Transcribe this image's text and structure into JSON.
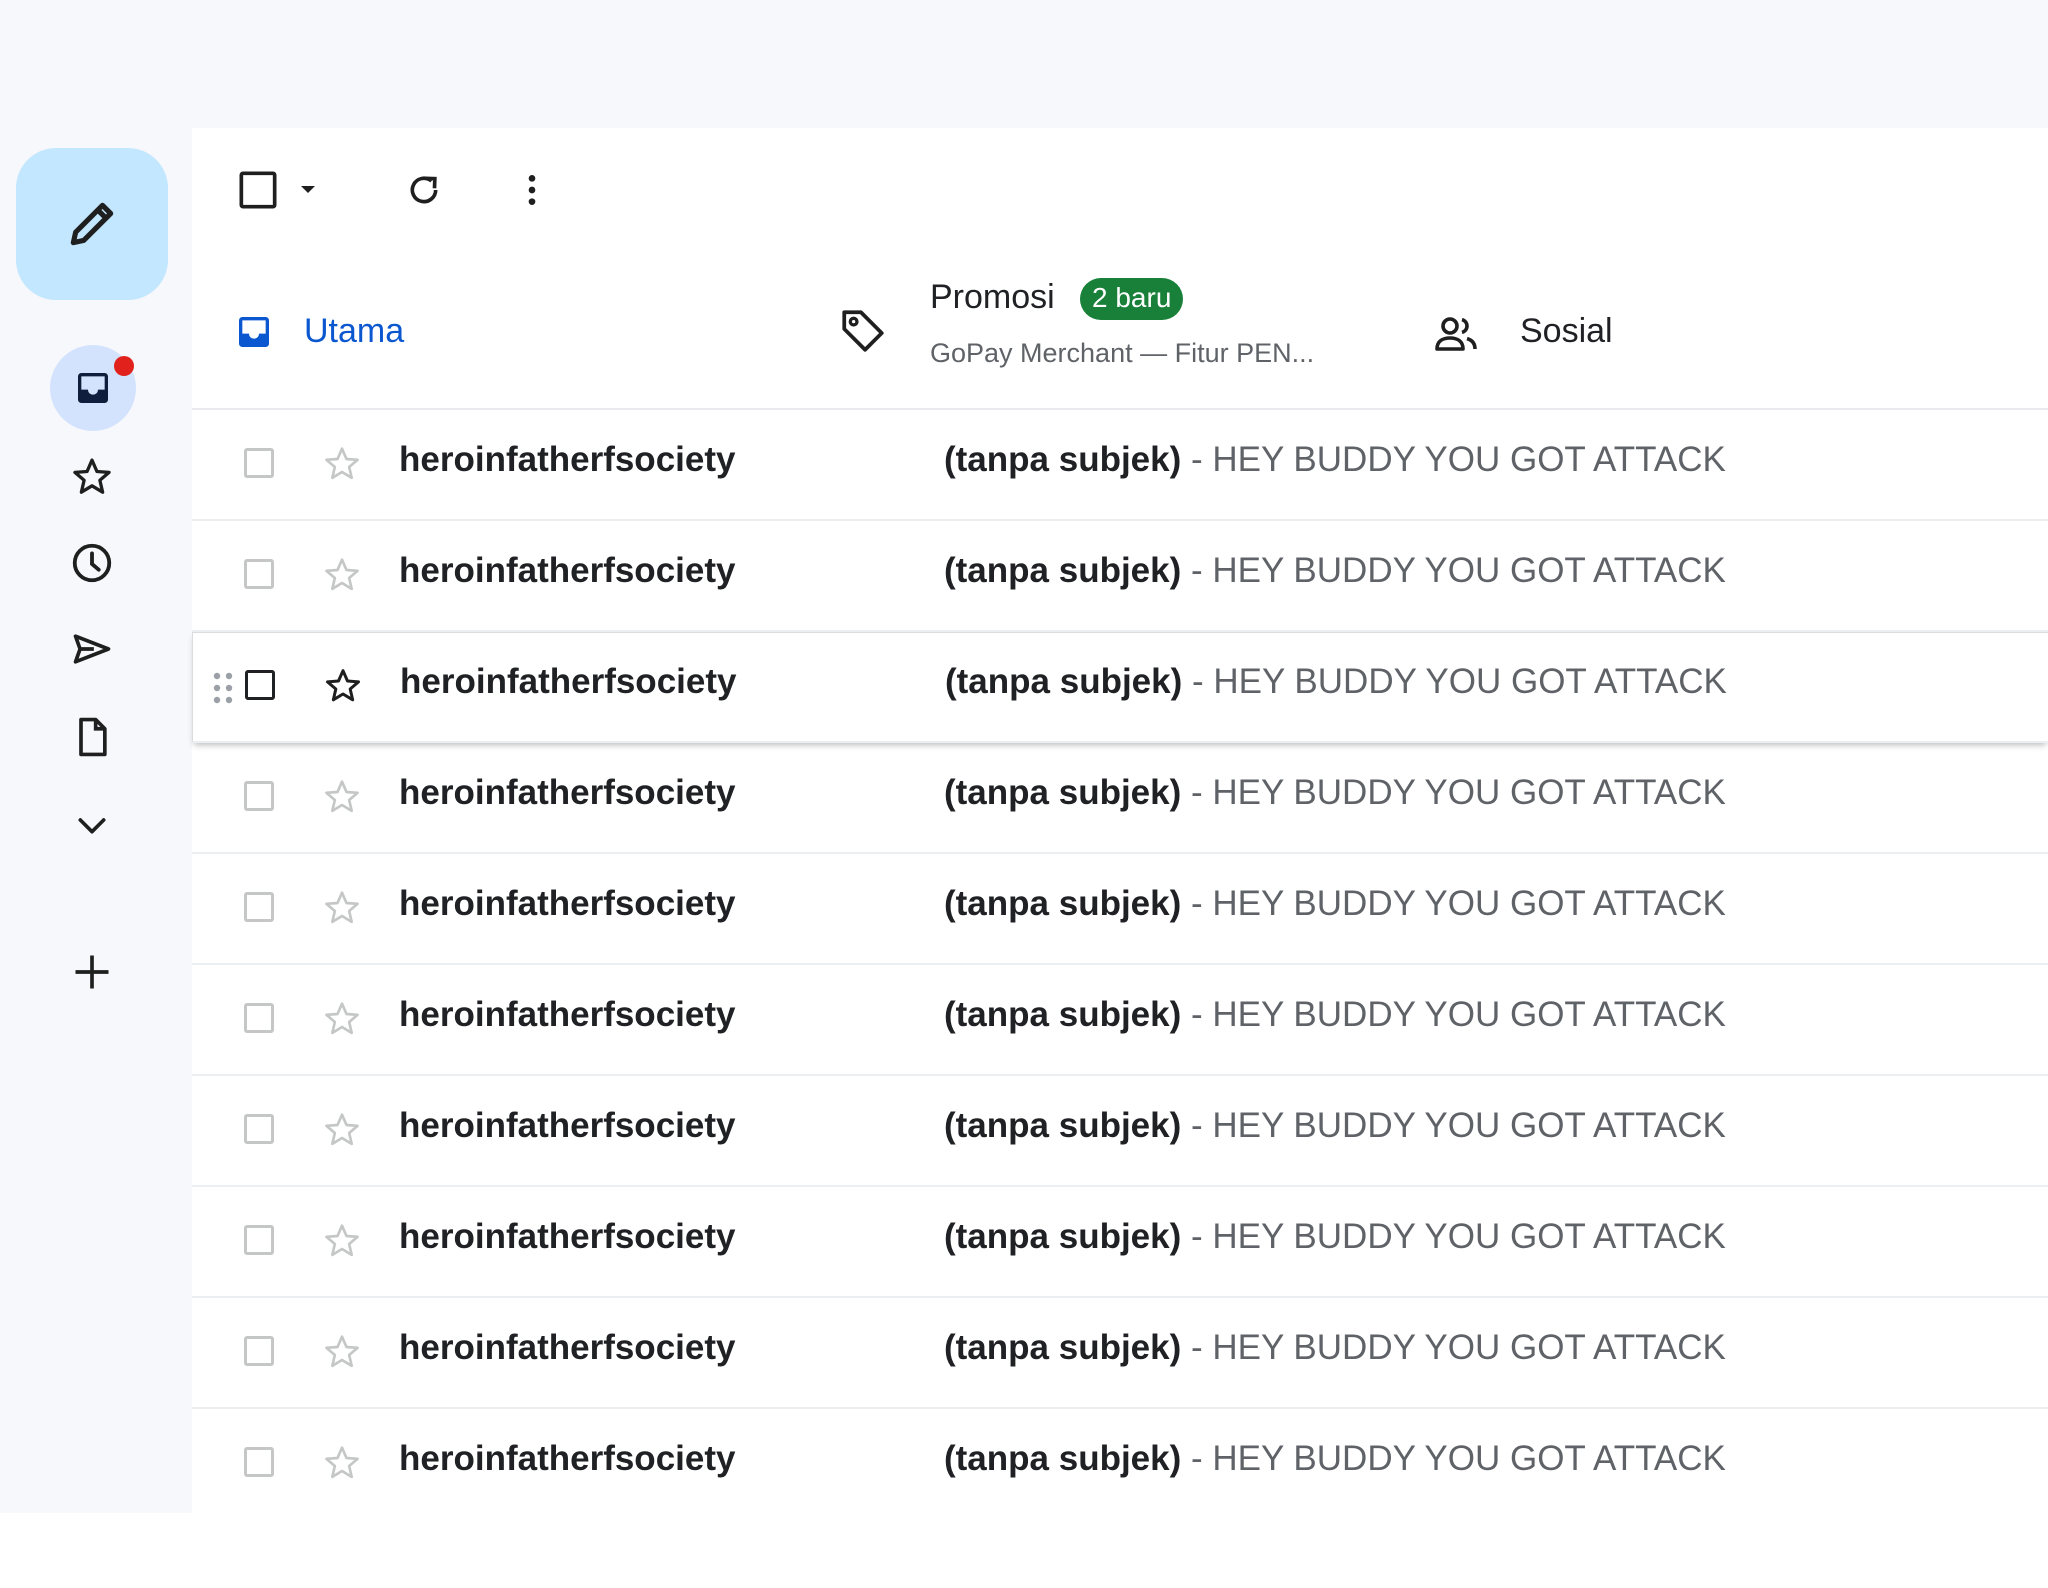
{
  "toolbar": {
    "select_all_icon": "checkbox-icon",
    "select_dropdown_icon": "caret-down-icon",
    "refresh_icon": "refresh-icon",
    "more_icon": "more-vert-icon"
  },
  "sidebar": {
    "compose_icon": "pencil-icon",
    "items": [
      {
        "icon": "inbox-icon",
        "active": true,
        "has_notification": true
      },
      {
        "icon": "star-icon"
      },
      {
        "icon": "clock-icon"
      },
      {
        "icon": "send-icon"
      },
      {
        "icon": "document-icon"
      },
      {
        "icon": "chevron-down-icon"
      },
      {
        "icon": "plus-icon"
      }
    ]
  },
  "tabs": [
    {
      "label": "Utama",
      "active": true
    },
    {
      "label": "Promosi",
      "badge": "2 baru",
      "subtitle": "GoPay Merchant — Fitur PEN..."
    },
    {
      "label": "Sosial"
    }
  ],
  "emails": [
    {
      "sender": "heroinfatherfsociety",
      "subject": "(tanpa subjek)",
      "separator": " - ",
      "snippet": "HEY BUDDY YOU GOT ATTACK"
    },
    {
      "sender": "heroinfatherfsociety",
      "subject": "(tanpa subjek)",
      "separator": " - ",
      "snippet": "HEY BUDDY YOU GOT ATTACK"
    },
    {
      "sender": "heroinfatherfsociety",
      "subject": "(tanpa subjek)",
      "separator": " - ",
      "snippet": "HEY BUDDY YOU GOT ATTACK"
    },
    {
      "sender": "heroinfatherfsociety",
      "subject": "(tanpa subjek)",
      "separator": " - ",
      "snippet": "HEY BUDDY YOU GOT ATTACK"
    },
    {
      "sender": "heroinfatherfsociety",
      "subject": "(tanpa subjek)",
      "separator": " - ",
      "snippet": "HEY BUDDY YOU GOT ATTACK"
    },
    {
      "sender": "heroinfatherfsociety",
      "subject": "(tanpa subjek)",
      "separator": " - ",
      "snippet": "HEY BUDDY YOU GOT ATTACK"
    },
    {
      "sender": "heroinfatherfsociety",
      "subject": "(tanpa subjek)",
      "separator": " - ",
      "snippet": "HEY BUDDY YOU GOT ATTACK"
    },
    {
      "sender": "heroinfatherfsociety",
      "subject": "(tanpa subjek)",
      "separator": " - ",
      "snippet": "HEY BUDDY YOU GOT ATTACK"
    },
    {
      "sender": "heroinfatherfsociety",
      "subject": "(tanpa subjek)",
      "separator": " - ",
      "snippet": "HEY BUDDY YOU GOT ATTACK"
    },
    {
      "sender": "heroinfatherfsociety",
      "subject": "(tanpa subjek)",
      "separator": " - ",
      "snippet": "HEY BUDDY YOU GOT ATTACK"
    }
  ],
  "colors": {
    "accent": "#0b57d0",
    "compose_bg": "#c2e7ff",
    "badge_bg": "#188038",
    "notification": "#e1221c"
  }
}
